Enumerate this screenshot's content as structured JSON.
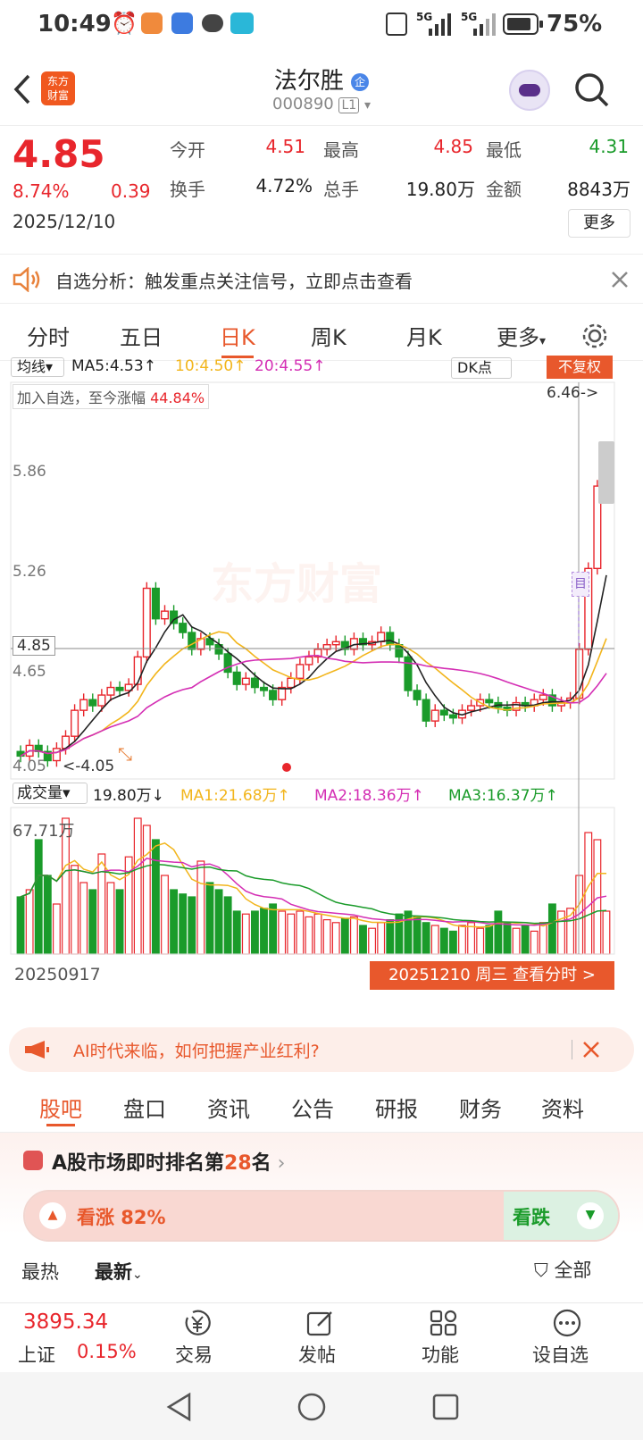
{
  "status": {
    "time": "10:49",
    "net1": "5G",
    "net2": "5G",
    "battery": "75%"
  },
  "header": {
    "logo_line1": "东方",
    "logo_line2": "财富",
    "title": "法尔胜",
    "badge": "企",
    "code": "000890",
    "level": "L1"
  },
  "quote": {
    "price": "4.85",
    "pct": "8.74%",
    "chg": "0.39",
    "date": "2025/12/10",
    "open_label": "今开",
    "open": "4.51",
    "high_label": "最高",
    "high": "4.85",
    "low_label": "最低",
    "low": "4.31",
    "turnover_label": "换手",
    "turnover": "4.72%",
    "volume_label": "总手",
    "volume": "19.80万",
    "amount_label": "金额",
    "amount": "8843万",
    "more": "更多"
  },
  "alert": {
    "text": "自选分析：触发重点关注信号，立即点击查看"
  },
  "tabs": [
    "分时",
    "五日",
    "日K",
    "周K",
    "月K",
    "更多"
  ],
  "chart": {
    "ma_select": "均线",
    "ma5": "MA5:4.53↑",
    "ma10": "10:4.50↑",
    "ma20": "20:4.55↑",
    "dk": "DK点",
    "fq": "不复权",
    "since_label": "加入自选，至今涨幅",
    "since_value": "44.84%",
    "max_marker": "6.46->",
    "min_marker": "<-4.05",
    "y_ticks": [
      "5.86",
      "5.26",
      "4.85",
      "4.65",
      "4.05"
    ],
    "vol_select": "成交量",
    "vol_value": "19.80万↓",
    "vma1": "MA1:21.68万↑",
    "vma2": "MA2:18.36万↑",
    "vma3": "MA3:16.37万↑",
    "vol_max": "67.71万",
    "start_date": "20250917",
    "end_info": "20251210 周三 查看分时 >",
    "watermark": "东方财富",
    "colors": {
      "up": "#e8262c",
      "down": "#1a9b2a",
      "ma5": "#222222",
      "ma10": "#f2b51c",
      "ma20": "#d42fb4"
    }
  },
  "banner": {
    "text": "AI时代来临，如何把握产业红利?"
  },
  "sectabs": [
    "股吧",
    "盘口",
    "资讯",
    "公告",
    "研报",
    "财务",
    "资料"
  ],
  "rank": {
    "prefix": "A股市场即时排名第",
    "num": "28",
    "suffix": "名",
    "up_label": "看涨 82%",
    "up_pct": 82,
    "down_label": "看跌"
  },
  "feed": {
    "hot": "最热",
    "new": "最新",
    "all": "全部"
  },
  "bottom": {
    "index_value": "3895.34",
    "index_name": "上证",
    "index_pct": "0.15%",
    "trade": "交易",
    "post": "发帖",
    "func": "功能",
    "watch": "设自选"
  }
}
